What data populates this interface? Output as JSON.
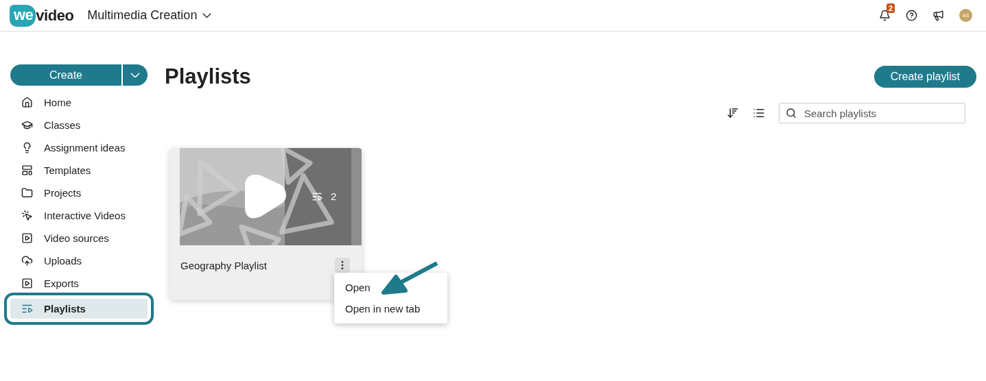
{
  "header": {
    "logo": {
      "part_1": "we",
      "part_2": "video"
    },
    "workspace": "Multimedia Creation",
    "notification_count": "2",
    "avatar": "AS"
  },
  "sidebar": {
    "create_button": "Create",
    "items": [
      {
        "label": "Home",
        "selected": false
      },
      {
        "label": "Classes",
        "selected": false
      },
      {
        "label": "Assignment ideas",
        "selected": false
      },
      {
        "label": "Templates",
        "selected": false
      },
      {
        "label": "Projects",
        "selected": false
      },
      {
        "label": "Interactive Videos",
        "selected": false
      },
      {
        "label": "Video sources",
        "selected": false
      },
      {
        "label": "Uploads",
        "selected": false
      },
      {
        "label": "Exports",
        "selected": false
      },
      {
        "label": "Playlists",
        "selected": true
      }
    ]
  },
  "page": {
    "title": "Playlists",
    "create_button": "Create playlist",
    "search": {
      "placeholder": "Search playlists"
    }
  },
  "playlists": [
    {
      "title": "Geography Playlist",
      "count": "2",
      "menu": [
        "Open",
        "Open in new tab"
      ]
    }
  ]
}
